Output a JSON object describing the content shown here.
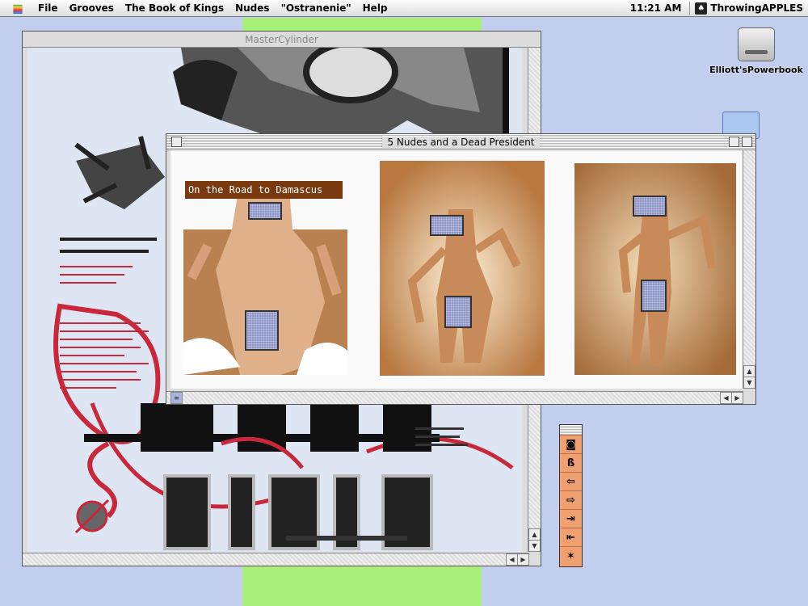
{
  "menubar": {
    "items": [
      "File",
      "Grooves",
      "The Book of Kings",
      "Nudes",
      "\"Ostranenie\"",
      "Help"
    ],
    "clock": "11:21 AM",
    "app_name": "ThrowingAPPLES"
  },
  "desktop": {
    "disk_label": "Elliott'sPowerbook"
  },
  "windows": {
    "master": {
      "title": "MasterCylinder"
    },
    "nudes": {
      "title": "5 Nudes and a Dead President",
      "caption": "On the Road to Damascus"
    }
  },
  "colors": {
    "desktop": "#c2ceee",
    "green_strip": "#a8f07a",
    "palette": "#f0a070",
    "censor": "#8c94c6"
  },
  "icons": [
    "apple-icon",
    "hard-disk-icon",
    "folder-icon",
    "collapse-box-icon",
    "zoom-box-icon",
    "scroll-arrow-icon"
  ]
}
